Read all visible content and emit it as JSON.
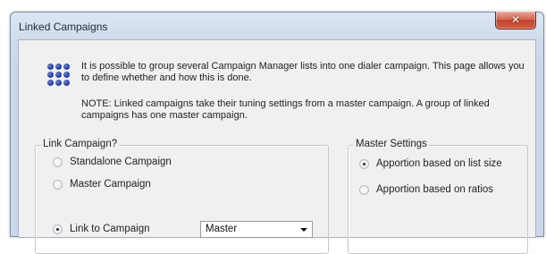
{
  "window": {
    "title": "Linked Campaigns",
    "close_glyph": "✕"
  },
  "icons": {
    "info": "info-dots-icon",
    "close": "close-icon",
    "dropdown": "chevron-down-icon"
  },
  "intro_text": "It is possible to group several Campaign Manager lists into one dialer campaign. This page allows you to define whether and how this is done.",
  "note_text": "NOTE: Linked campaigns take their tuning settings from a master campaign. A group of linked campaigns has one master campaign.",
  "link_campaign": {
    "caption": "Link Campaign?",
    "options": [
      {
        "label": "Standalone Campaign",
        "checked": false
      },
      {
        "label": "Master Campaign",
        "checked": false
      },
      {
        "label": "Link to Campaign",
        "checked": true
      }
    ],
    "combo": {
      "value": "Master"
    }
  },
  "master_settings": {
    "caption": "Master Settings",
    "options": [
      {
        "label": "Apportion based on list size",
        "checked": true
      },
      {
        "label": "Apportion based on ratios",
        "checked": false
      }
    ]
  },
  "colors": {
    "window_frame": "#c9d7e9",
    "client_bg": "#f0f0f0",
    "close_button": "#c2442c",
    "icon_blue": "#2a3f9c"
  }
}
